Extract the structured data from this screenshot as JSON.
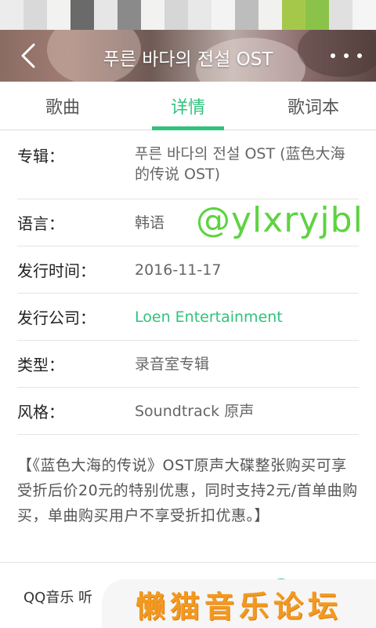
{
  "status_bar": {
    "colors": [
      "#ececec",
      "#d9d9d9",
      "#f2f2f0",
      "#6a6a6a",
      "#e6e6e6",
      "#8a8a8a",
      "#f2f2f0",
      "#d6d6d6",
      "#e8e8e8",
      "#f3f3f3",
      "#bdbdbd",
      "#f1f1ef",
      "#a6c84a",
      "#8bc34a",
      "#e0e0e0",
      "#f5f5f5"
    ]
  },
  "header": {
    "title": "푸른 바다의 전설 OST"
  },
  "tabs": [
    {
      "label": "歌曲"
    },
    {
      "label": "详情"
    },
    {
      "label": "歌词本"
    }
  ],
  "details": {
    "album": {
      "label": "专辑：",
      "value": "푸른 바다의 전설 OST (蓝色大海的传说 OST)"
    },
    "language": {
      "label": "语言：",
      "value": "韩语"
    },
    "release_date": {
      "label": "发行时间：",
      "value": "2016-11-17"
    },
    "publisher": {
      "label": "发行公司：",
      "value": "Loen Entertainment"
    },
    "type": {
      "label": "类型：",
      "value": "录音室专辑"
    },
    "style": {
      "label": "风格：",
      "value": "Soundtrack 原声"
    }
  },
  "description": "【《蓝色大海的传说》OST原声大碟整张购买可享受折后价20元的特别优惠，同时支持2元/首单曲购买，单曲购买用户不享受折扣优惠。】",
  "bottom": {
    "text": "QQ音乐 听"
  },
  "watermark": "@ylxryjbl",
  "forum_banner": "懒猫音乐论坛",
  "colors": {
    "accent": "#31c27c"
  }
}
